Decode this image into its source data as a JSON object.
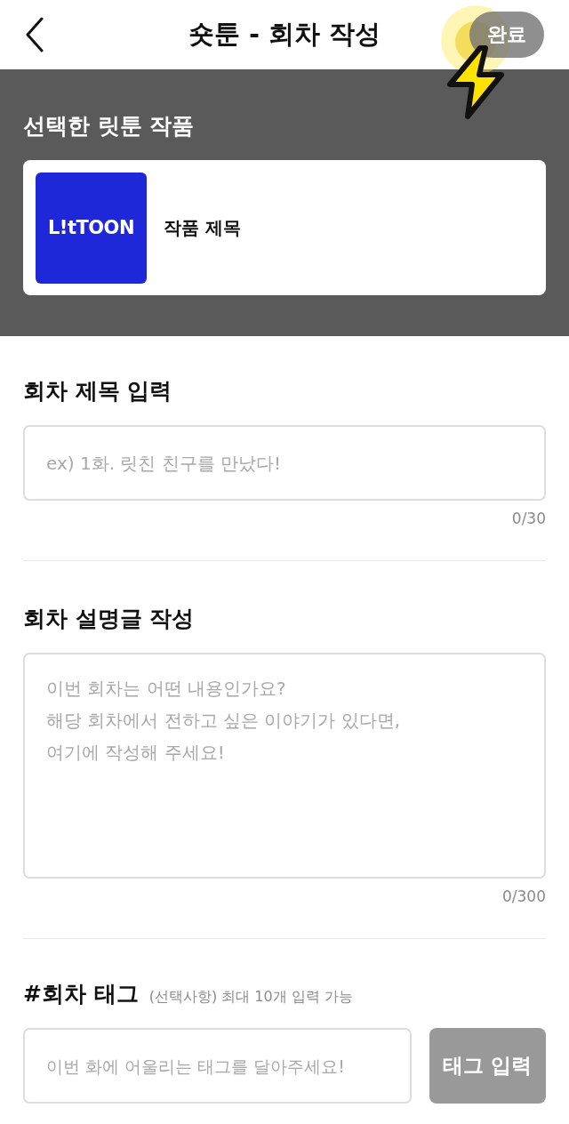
{
  "header": {
    "title": "숏툰 - 회차 작성",
    "done_button": {
      "label": "완료",
      "disabled": true
    }
  },
  "selected_work": {
    "heading": "선택한 릿툰 작품",
    "logo": "L!tTOON",
    "title": "작품 제목"
  },
  "episode_title": {
    "heading": "회차 제목 입력",
    "placeholder": "ex) 1화. 릿친 친구를 만났다!",
    "counter": "0/30"
  },
  "description": {
    "heading": "회차 설명글 작성",
    "placeholder": "이번 회차는 어떤 내용인가요?\n해당 회차에서 전하고 싶은 이야기가 있다면,\n여기에 작성해 주세요!",
    "counter": "0/300"
  },
  "tags": {
    "heading": "#회차 태그",
    "note": "(선택사항) 최대 10개 입력 가능",
    "placeholder": "이번 화에 어울리는 태그를 달아주세요!",
    "button": {
      "label": "태그 입력",
      "disabled": true
    }
  }
}
